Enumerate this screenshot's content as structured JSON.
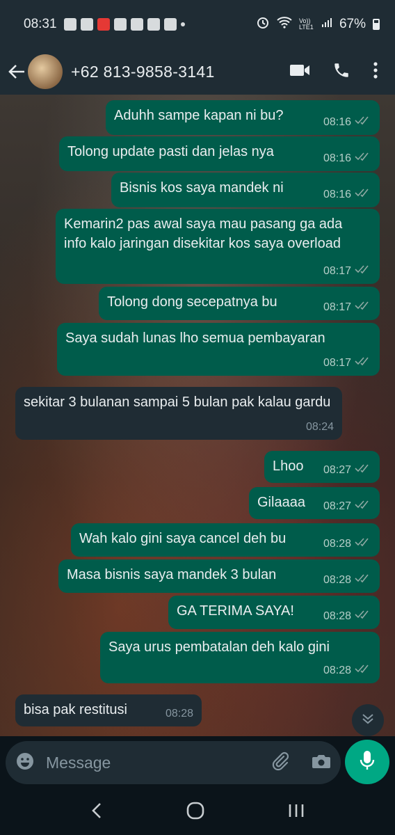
{
  "status_bar": {
    "time": "08:31",
    "network": "Vo)) LTE1",
    "battery": "67%"
  },
  "header": {
    "contact": "+62 813-9858-3141"
  },
  "messages": [
    {
      "text": "Aduhh sampe kapan ni bu?",
      "time": "08:16"
    },
    {
      "text": "Tolong update pasti dan jelas nya",
      "time": "08:16"
    },
    {
      "text": "Bisnis kos saya mandek ni",
      "time": "08:16"
    },
    {
      "text": "Kemarin2 pas awal saya mau pasang ga ada info kalo jaringan disekitar kos saya overload",
      "time": "08:17"
    },
    {
      "text": "Tolong dong secepatnya bu",
      "time": "08:17"
    },
    {
      "text": "Saya sudah lunas lho semua pembayaran",
      "time": "08:17"
    },
    {
      "text": "sekitar 3 bulanan sampai 5 bulan pak kalau gardu",
      "time": "08:24"
    },
    {
      "text": "Lhoo",
      "time": "08:27"
    },
    {
      "text": "Gilaaaa",
      "time": "08:27"
    },
    {
      "text": "Wah kalo gini saya cancel deh bu",
      "time": "08:28"
    },
    {
      "text": "Masa bisnis saya mandek 3 bulan",
      "time": "08:28"
    },
    {
      "text": "GA TERIMA SAYA!",
      "time": "08:28"
    },
    {
      "text": "Saya urus pembatalan deh kalo gini",
      "time": "08:28"
    },
    {
      "text": "bisa pak restitusi",
      "time": "08:28"
    }
  ],
  "composer": {
    "placeholder": "Message"
  },
  "colors": {
    "outgoing": "#005c4b",
    "incoming": "#1f2c34",
    "accent": "#00a884",
    "ticks": "#8696a0"
  },
  "icons": [
    "back-arrow-icon",
    "video-call-icon",
    "phone-icon",
    "more-options-icon",
    "emoji-icon",
    "attach-icon",
    "camera-icon",
    "mic-icon",
    "chevron-down-icon",
    "nav-back-icon",
    "nav-home-icon",
    "nav-recents-icon"
  ]
}
